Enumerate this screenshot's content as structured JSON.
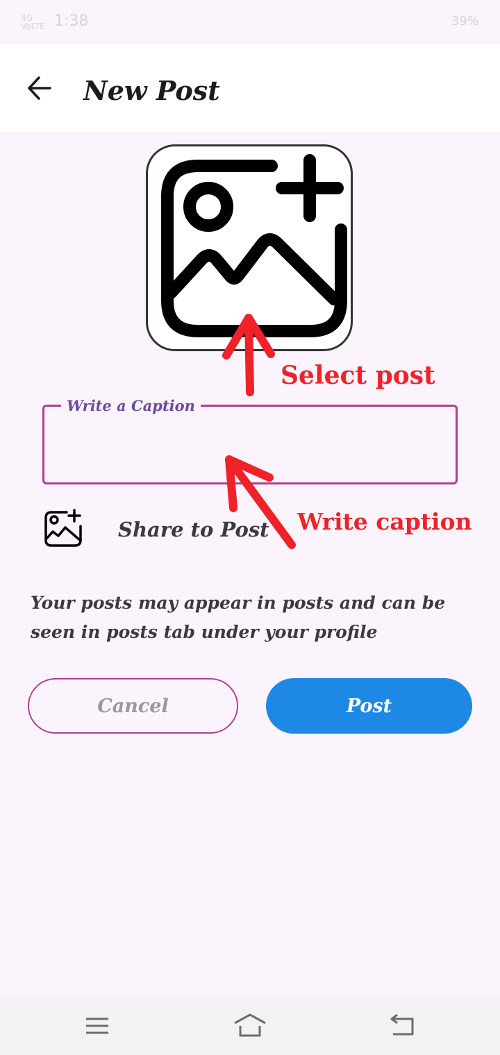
{
  "status_bar": {
    "time": "1:38",
    "left_indicator_top": "4G",
    "left_indicator_bottom": "VoLTE",
    "right_text": "39%"
  },
  "header": {
    "title": "New Post"
  },
  "caption_field": {
    "label": "Write a Caption",
    "value": ""
  },
  "share": {
    "label": "Share to Post"
  },
  "notice": "Your posts may appear in posts and can be seen in posts tab under your profile",
  "buttons": {
    "cancel": "Cancel",
    "post": "Post"
  },
  "annotations": {
    "select_post": "Select post",
    "write_caption": "Write caption"
  },
  "colors": {
    "background": "#fcf4fd",
    "accent_outline": "#b03e8f",
    "primary_button": "#1e88e5",
    "annotation_red": "#ee2228",
    "caption_label": "#6b4b9b"
  },
  "icons": [
    "back-arrow-icon",
    "add-photo-icon",
    "add-photo-small-icon",
    "menu-icon",
    "home-icon",
    "back-nav-icon"
  ]
}
